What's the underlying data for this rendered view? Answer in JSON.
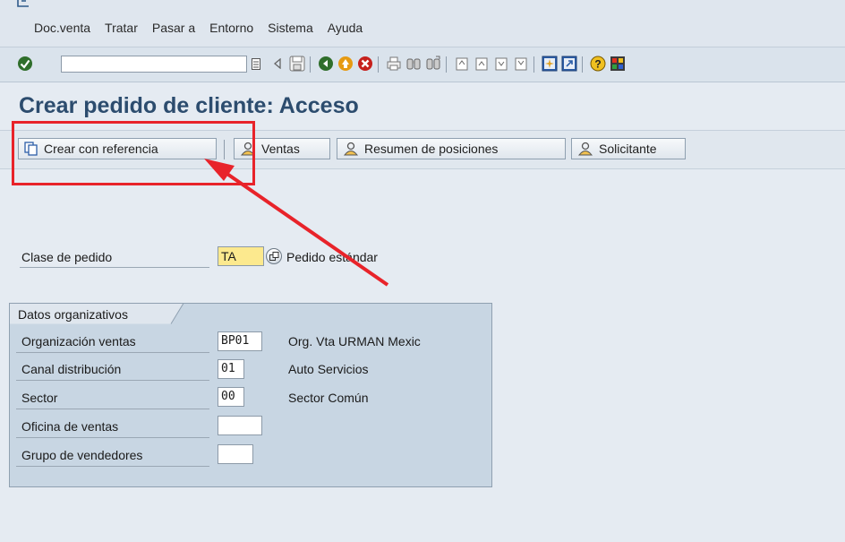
{
  "menu": [
    "Doc.venta",
    "Tratar",
    "Pasar a",
    "Entorno",
    "Sistema",
    "Ayuda"
  ],
  "toolbar": {
    "command_field_value": ""
  },
  "title": "Crear pedido de cliente: Acceso",
  "app_toolbar": {
    "create_with_ref": "Crear con referencia",
    "sales": "Ventas",
    "item_overview": "Resumen de posiciones",
    "sold_to": "Solicitante"
  },
  "order": {
    "label": "Clase de pedido",
    "value": "TA",
    "description": "Pedido estándar"
  },
  "org_data": {
    "title": "Datos organizativos",
    "sales_org": {
      "label": "Organización ventas",
      "value": "BP01",
      "description": "Org. Vta URMAN Mexic"
    },
    "distribution_channel": {
      "label": "Canal distribución",
      "value": "01",
      "description": "Auto Servicios"
    },
    "division": {
      "label": "Sector",
      "value": "00",
      "description": "Sector Común"
    },
    "sales_office": {
      "label": "Oficina de ventas",
      "value": ""
    },
    "sales_group": {
      "label": "Grupo de vendedores",
      "value": ""
    }
  },
  "colors": {
    "highlight": "#e8232a",
    "title": "#2c4c6e",
    "required_field": "#fce98e",
    "group_box": "#c8d6e3"
  }
}
